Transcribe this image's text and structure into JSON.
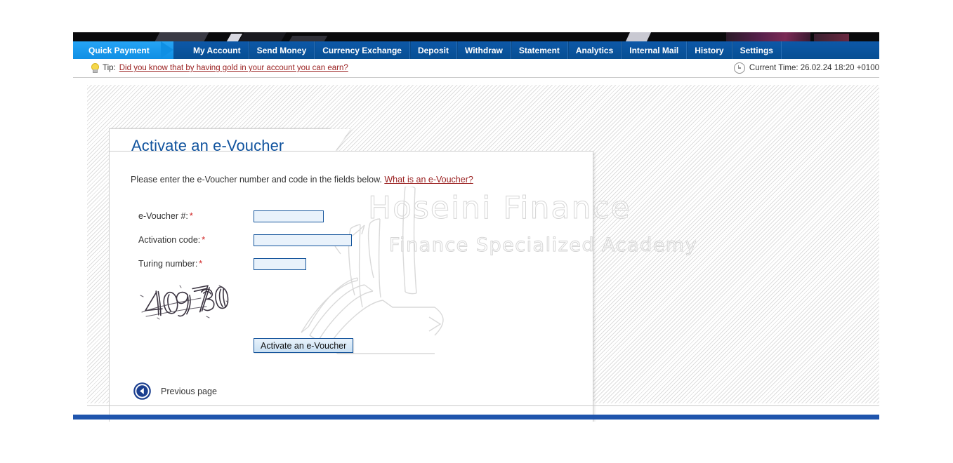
{
  "nav": {
    "active": {
      "label": "Quick Payment",
      "icon": "arrow-tab"
    },
    "items": [
      {
        "label": "My Account"
      },
      {
        "label": "Send Money"
      },
      {
        "label": "Currency Exchange"
      },
      {
        "label": "Deposit"
      },
      {
        "label": "Withdraw"
      },
      {
        "label": "Statement"
      },
      {
        "label": "Analytics"
      },
      {
        "label": "Internal Mail"
      },
      {
        "label": "History"
      },
      {
        "label": "Settings"
      }
    ]
  },
  "tipbar": {
    "bulb_icon": "lightbulb-icon",
    "label": "Tip:",
    "link": "Did you know that by having gold in your account you can earn?",
    "clock_icon": "clock-icon",
    "time": "Current Time: 26.02.24 18:20 +0100"
  },
  "card": {
    "title": "Activate an e-Voucher",
    "intro_text": "Please enter the e-Voucher number and code in the fields below.",
    "intro_link": "What is an e-Voucher?",
    "fields": [
      {
        "label": "e-Voucher #:",
        "required": "*",
        "value": "",
        "placeholder": "",
        "width": "w-voucher"
      },
      {
        "label": "Activation code:",
        "required": "*",
        "value": "",
        "placeholder": "",
        "width": "w-code"
      },
      {
        "label": "Turing number:",
        "required": "*",
        "value": "",
        "placeholder": "",
        "width": "w-turing"
      }
    ],
    "captcha": {
      "icon": "captcha-image",
      "text": "409730"
    },
    "submit_label": "Activate an e-Voucher",
    "previous": {
      "icon": "back-arrow-circle-icon",
      "label": "Previous page"
    }
  },
  "watermark": {
    "line1": "Hoseini Finance",
    "line2": "Finance Specialized Academy",
    "art": "graduation-cap-line-art"
  },
  "colors": {
    "nav_blue": "#0b529e",
    "active_tab_blue": "#1a9cf0",
    "title_blue": "#10539e",
    "link_red": "#9a2020",
    "required_red": "#d02020",
    "field_border": "#15559c",
    "field_fill": "#e9f2fb",
    "footer_blue": "#1f55ad"
  }
}
